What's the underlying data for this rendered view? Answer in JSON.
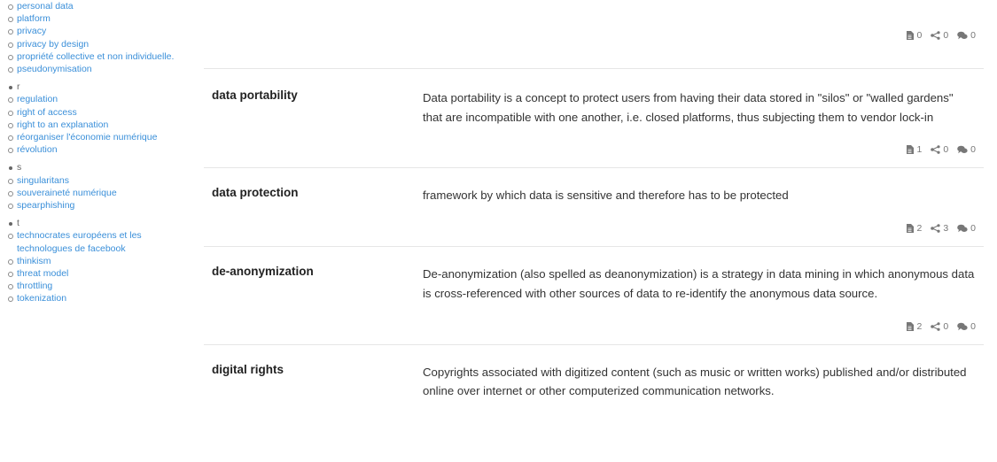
{
  "sidebar": {
    "items": [
      {
        "type": "entry",
        "label": "personal data"
      },
      {
        "type": "entry",
        "label": "platform"
      },
      {
        "type": "entry",
        "label": "privacy"
      },
      {
        "type": "entry",
        "label": "privacy by design"
      },
      {
        "type": "entry",
        "label": "propriété collective et non individuelle."
      },
      {
        "type": "entry",
        "label": "pseudonymisation"
      },
      {
        "type": "letter",
        "label": "r"
      },
      {
        "type": "entry",
        "label": "regulation"
      },
      {
        "type": "entry",
        "label": "right of access"
      },
      {
        "type": "entry",
        "label": "right to an explanation"
      },
      {
        "type": "entry",
        "label": "réorganiser l'économie numérique"
      },
      {
        "type": "entry",
        "label": "révolution"
      },
      {
        "type": "letter",
        "label": "s"
      },
      {
        "type": "entry",
        "label": "singularitans"
      },
      {
        "type": "entry",
        "label": "souveraineté numérique"
      },
      {
        "type": "entry",
        "label": "spearphishing"
      },
      {
        "type": "letter",
        "label": "t"
      },
      {
        "type": "entry",
        "label": "technocrates européens et les technologues de facebook"
      },
      {
        "type": "entry",
        "label": "thinkism"
      },
      {
        "type": "entry",
        "label": "threat model"
      },
      {
        "type": "entry",
        "label": "throttling"
      },
      {
        "type": "entry",
        "label": "tokenization"
      }
    ]
  },
  "main": {
    "top_stats": {
      "docs": "0",
      "shares": "0",
      "comments": "0"
    },
    "entries": [
      {
        "term": "data portability",
        "definition": "Data portability is a concept to protect users from having their data stored in \"silos\" or \"walled gardens\" that are incompatible with one another, i.e. closed platforms, thus subjecting them to vendor lock-in",
        "stats": {
          "docs": "1",
          "shares": "0",
          "comments": "0"
        }
      },
      {
        "term": "data protection",
        "definition": "framework by which data is sensitive and therefore has to be protected",
        "stats": {
          "docs": "2",
          "shares": "3",
          "comments": "0"
        }
      },
      {
        "term": "de-anonymization",
        "definition": "De-anonymization (also spelled as deanonymization) is a strategy in data mining in which anonymous data is cross-referenced with other sources of data to re-identify the anonymous data source.",
        "stats": {
          "docs": "2",
          "shares": "0",
          "comments": "0"
        }
      },
      {
        "term": "digital rights",
        "definition": "Copyrights associated with digitized content (such as music or written works) published and/or distributed online over internet or other computerized communication networks."
      }
    ]
  },
  "icons": {
    "doc": "document-icon",
    "share": "share-icon",
    "comment": "comments-icon"
  },
  "colors": {
    "link": "#3a8fd9",
    "muted": "#777777",
    "divider": "#e6e6e6"
  }
}
